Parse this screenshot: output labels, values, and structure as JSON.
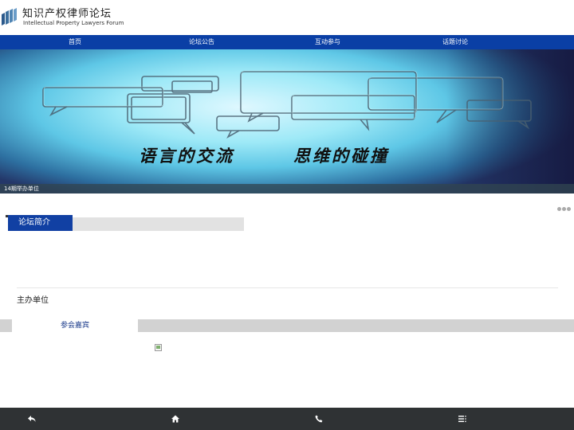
{
  "header": {
    "title": "知识产权律师论坛",
    "subtitle": "Intellectual Property Lawyers Forum",
    "logo_icon": "forum-logo-icon"
  },
  "nav": {
    "items": [
      {
        "label": "首页"
      },
      {
        "label": "论坛公告"
      },
      {
        "label": "互动参与"
      },
      {
        "label": "话题讨论"
      }
    ],
    "background": "#0a3fa5"
  },
  "banner": {
    "slogan_left": "语言的交流",
    "slogan_right": "思维的碰撞",
    "caption": "14期举办单位"
  },
  "slider": {
    "dot_count": 3
  },
  "intro": {
    "label": "论坛简介",
    "accent": "#1140a3"
  },
  "host": {
    "title": "主办单位"
  },
  "guests": {
    "label": "参会嘉宾"
  },
  "footer": {
    "buttons": [
      {
        "icon": "back-icon"
      },
      {
        "icon": "home-icon"
      },
      {
        "icon": "phone-icon"
      },
      {
        "icon": "menu-icon"
      }
    ],
    "background": "#2f3234"
  }
}
